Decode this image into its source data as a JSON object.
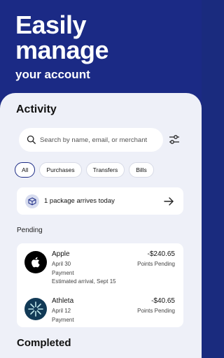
{
  "hero": {
    "title_line1": "Easily",
    "title_line2": "manage",
    "subtitle": "your account"
  },
  "activity": {
    "title": "Activity",
    "search": {
      "placeholder": "Search by name, email, or merchant"
    },
    "filters": [
      "All",
      "Purchases",
      "Transfers",
      "Bills"
    ],
    "active_filter": "All",
    "package_notice": "1 package arrives today",
    "pending_label": "Pending",
    "pending": [
      {
        "name": "Apple",
        "date": "April 30",
        "type": "Payment",
        "note": "Estimated arrival, Sept 15",
        "amount": "-$240.65",
        "status": "Points Pending",
        "logo_icon": "apple-logo-icon"
      },
      {
        "name": "Athleta",
        "date": "April 12",
        "type": "Payment",
        "amount": "-$40.65",
        "status": "Points Pending",
        "logo_icon": "athleta-logo-icon"
      }
    ],
    "completed_label": "Completed"
  },
  "colors": {
    "brand_navy": "#1b2a85",
    "sheet_bg": "#eef0f8",
    "card_bg": "#ffffff"
  }
}
